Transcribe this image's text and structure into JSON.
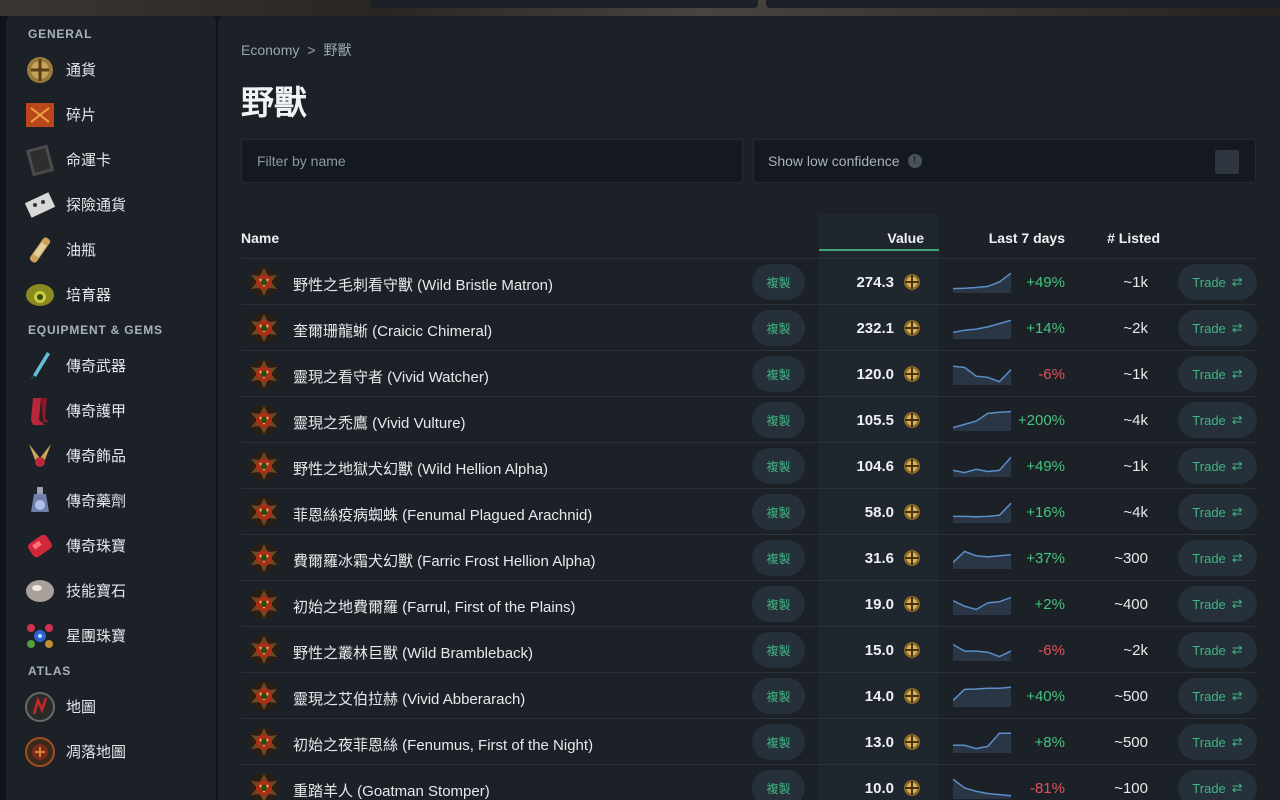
{
  "colors": {
    "accent": "#3fb583",
    "up": "#45c47f",
    "down": "#e0525a",
    "spark": "#5b8fc9"
  },
  "sidebar": {
    "sections": [
      {
        "title": "GENERAL",
        "items": [
          {
            "label": "通貨",
            "icon": "currency-orb-icon"
          },
          {
            "label": "碎片",
            "icon": "fragment-icon"
          },
          {
            "label": "命運卡",
            "icon": "divination-card-icon"
          },
          {
            "label": "探險通貨",
            "icon": "expedition-currency-icon"
          },
          {
            "label": "油瓶",
            "icon": "oil-icon"
          },
          {
            "label": "培育器",
            "icon": "incubator-icon"
          }
        ]
      },
      {
        "title": "EQUIPMENT & GEMS",
        "items": [
          {
            "label": "傳奇武器",
            "icon": "unique-weapon-icon"
          },
          {
            "label": "傳奇護甲",
            "icon": "unique-armour-icon"
          },
          {
            "label": "傳奇飾品",
            "icon": "unique-accessory-icon"
          },
          {
            "label": "傳奇藥劑",
            "icon": "unique-flask-icon"
          },
          {
            "label": "傳奇珠寶",
            "icon": "unique-jewel-icon"
          },
          {
            "label": "技能寶石",
            "icon": "skill-gem-icon"
          },
          {
            "label": "星團珠寶",
            "icon": "cluster-jewel-icon"
          }
        ]
      },
      {
        "title": "ATLAS",
        "items": [
          {
            "label": "地圖",
            "icon": "map-icon"
          },
          {
            "label": "凋落地圖",
            "icon": "blighted-map-icon"
          }
        ]
      }
    ]
  },
  "breadcrumb": {
    "parent": "Economy",
    "separator": ">",
    "current": "野獸"
  },
  "page_title": "野獸",
  "filter": {
    "placeholder": "Filter by name",
    "value": ""
  },
  "low_confidence": {
    "label": "Show low confidence",
    "info": "!",
    "checked": false
  },
  "table": {
    "headers": {
      "name": "Name",
      "value": "Value",
      "last7": "Last 7 days",
      "listed": "# Listed"
    },
    "copy_label": "複製",
    "trade_label": "Trade",
    "rows": [
      {
        "name": "野性之毛刺看守獸 (Wild Bristle Matron)",
        "value": "274.3",
        "change": "+49%",
        "dir": "up",
        "listed": "~1k",
        "trend": [
          0.2,
          0.22,
          0.25,
          0.3,
          0.5,
          0.9
        ]
      },
      {
        "name": "奎爾珊龍蜥 (Craicic Chimeral)",
        "value": "232.1",
        "change": "+14%",
        "dir": "up",
        "listed": "~2k",
        "trend": [
          0.3,
          0.4,
          0.45,
          0.55,
          0.7,
          0.85
        ]
      },
      {
        "name": "靈現之看守者 (Vivid Watcher)",
        "value": "120.0",
        "change": "-6%",
        "dir": "down",
        "listed": "~1k",
        "trend": [
          0.85,
          0.8,
          0.4,
          0.35,
          0.15,
          0.7
        ]
      },
      {
        "name": "靈現之禿鷹 (Vivid Vulture)",
        "value": "105.5",
        "change": "+200%",
        "dir": "up",
        "listed": "~4k",
        "trend": [
          0.15,
          0.3,
          0.45,
          0.8,
          0.85,
          0.88
        ]
      },
      {
        "name": "野性之地獄犬幻獸 (Wild Hellion Alpha)",
        "value": "104.6",
        "change": "+49%",
        "dir": "up",
        "listed": "~1k",
        "trend": [
          0.3,
          0.2,
          0.35,
          0.25,
          0.3,
          0.9
        ]
      },
      {
        "name": "菲恩絲疫病蜘蛛 (Fenumal Plagued Arachnid)",
        "value": "58.0",
        "change": "+16%",
        "dir": "up",
        "listed": "~4k",
        "trend": [
          0.3,
          0.3,
          0.28,
          0.3,
          0.35,
          0.9
        ]
      },
      {
        "name": "費爾羅冰霜犬幻獸 (Farric Frost Hellion Alpha)",
        "value": "31.6",
        "change": "+37%",
        "dir": "up",
        "listed": "~300",
        "trend": [
          0.3,
          0.8,
          0.6,
          0.55,
          0.6,
          0.65
        ]
      },
      {
        "name": "初始之地費爾羅 (Farrul, First of the Plains)",
        "value": "19.0",
        "change": "+2%",
        "dir": "up",
        "listed": "~400",
        "trend": [
          0.65,
          0.4,
          0.25,
          0.55,
          0.6,
          0.8
        ]
      },
      {
        "name": "野性之叢林巨獸 (Wild Brambleback)",
        "value": "15.0",
        "change": "-6%",
        "dir": "down",
        "listed": "~2k",
        "trend": [
          0.75,
          0.45,
          0.45,
          0.4,
          0.2,
          0.45
        ]
      },
      {
        "name": "靈現之艾伯拉赫 (Vivid Abberarach)",
        "value": "14.0",
        "change": "+40%",
        "dir": "up",
        "listed": "~500",
        "trend": [
          0.3,
          0.8,
          0.82,
          0.85,
          0.85,
          0.9
        ]
      },
      {
        "name": "初始之夜菲恩絲 (Fenumus, First of the Night)",
        "value": "13.0",
        "change": "+8%",
        "dir": "up",
        "listed": "~500",
        "trend": [
          0.35,
          0.35,
          0.2,
          0.3,
          0.9,
          0.9
        ]
      },
      {
        "name": "重踏羊人 (Goatman Stomper)",
        "value": "10.0",
        "change": "-81%",
        "dir": "down",
        "listed": "~100",
        "trend": [
          0.9,
          0.5,
          0.35,
          0.25,
          0.2,
          0.15
        ]
      }
    ]
  }
}
